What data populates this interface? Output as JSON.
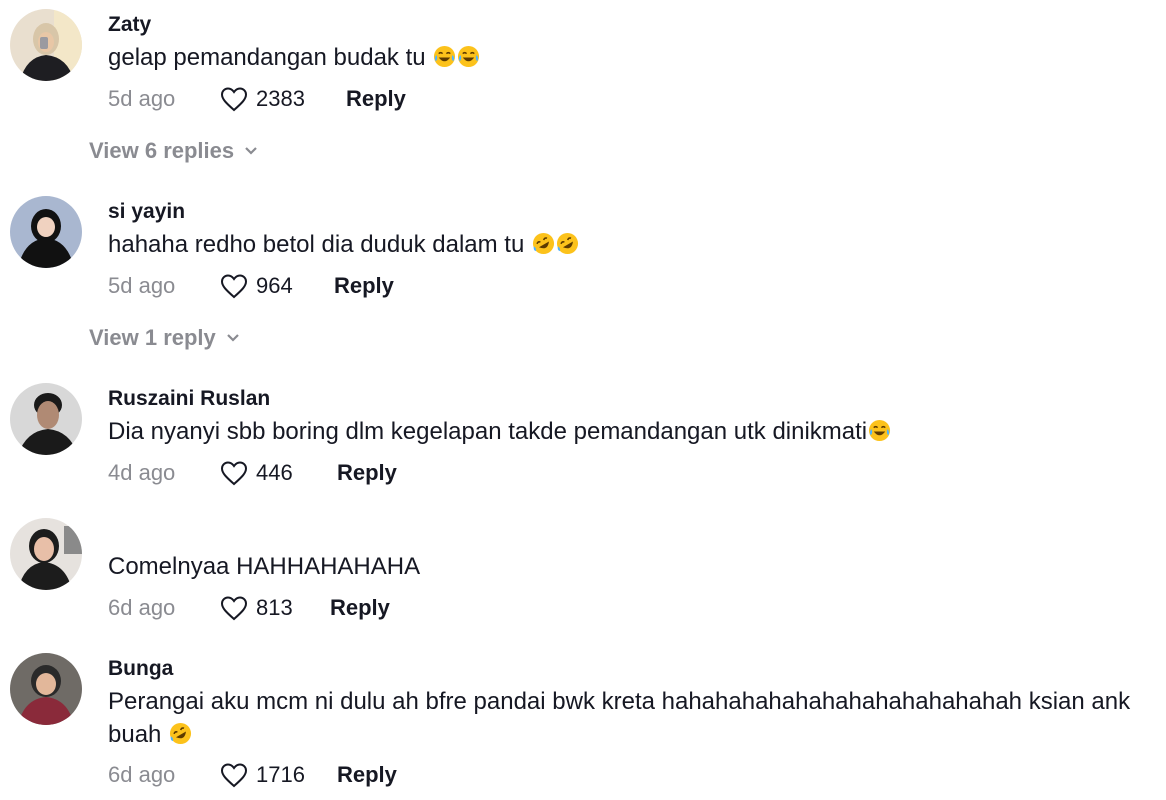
{
  "comments": [
    {
      "username": "Zaty",
      "text": "gelap pemandangan budak tu",
      "emoji_icons": [
        "tears-of-joy-emoji",
        "tears-of-joy-emoji"
      ],
      "time": "5d ago",
      "likes": "2383",
      "reply_label": "Reply",
      "view_replies": "View 6 replies"
    },
    {
      "username": "si yayin",
      "text": "hahaha redho betol dia duduk dalam tu",
      "emoji_icons": [
        "rolling-on-floor-laughing-emoji",
        "rolling-on-floor-laughing-emoji"
      ],
      "time": "5d ago",
      "likes": "964",
      "reply_label": "Reply",
      "view_replies": "View 1 reply"
    },
    {
      "username": "Ruszaini Ruslan",
      "text": "Dia nyanyi sbb boring dlm kegelapan takde pemandangan utk dinikmati",
      "emoji_icons": [
        "tears-of-joy-emoji"
      ],
      "time": "4d ago",
      "likes": "446",
      "reply_label": "Reply"
    },
    {
      "username": "",
      "text": "Comelnyaa HAHHAHAHAHA",
      "emoji_icons": [],
      "time": "6d ago",
      "likes": "813",
      "reply_label": "Reply"
    },
    {
      "username": "Bunga",
      "text": "Perangai aku mcm ni dulu ah bfre pandai bwk kreta hahahahahahahahahahahahahah ksian ank buah",
      "emoji_icons": [
        "rolling-on-floor-laughing-emoji"
      ],
      "time": "6d ago",
      "likes": "1716",
      "reply_label": "Reply"
    }
  ],
  "colors": {
    "text": "#161823",
    "muted": "#8a8b91",
    "background": "#ffffff"
  }
}
